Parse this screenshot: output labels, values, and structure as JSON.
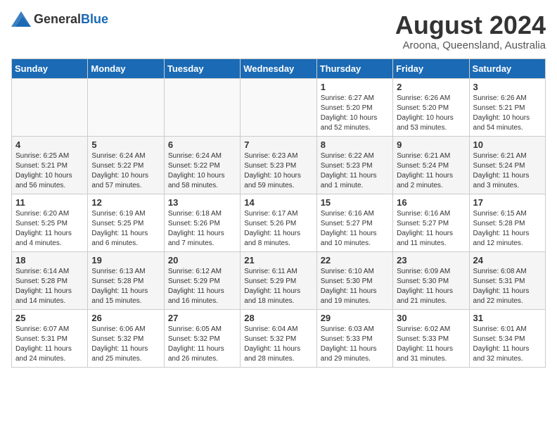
{
  "header": {
    "logo_general": "General",
    "logo_blue": "Blue",
    "month_title": "August 2024",
    "location": "Aroona, Queensland, Australia"
  },
  "days_of_week": [
    "Sunday",
    "Monday",
    "Tuesday",
    "Wednesday",
    "Thursday",
    "Friday",
    "Saturday"
  ],
  "weeks": [
    [
      {
        "day": "",
        "empty": true
      },
      {
        "day": "",
        "empty": true
      },
      {
        "day": "",
        "empty": true
      },
      {
        "day": "",
        "empty": true
      },
      {
        "day": "1",
        "sunrise": "6:27 AM",
        "sunset": "5:20 PM",
        "daylight": "10 hours and 52 minutes."
      },
      {
        "day": "2",
        "sunrise": "6:26 AM",
        "sunset": "5:20 PM",
        "daylight": "10 hours and 53 minutes."
      },
      {
        "day": "3",
        "sunrise": "6:26 AM",
        "sunset": "5:21 PM",
        "daylight": "10 hours and 54 minutes."
      }
    ],
    [
      {
        "day": "4",
        "sunrise": "6:25 AM",
        "sunset": "5:21 PM",
        "daylight": "10 hours and 56 minutes."
      },
      {
        "day": "5",
        "sunrise": "6:24 AM",
        "sunset": "5:22 PM",
        "daylight": "10 hours and 57 minutes."
      },
      {
        "day": "6",
        "sunrise": "6:24 AM",
        "sunset": "5:22 PM",
        "daylight": "10 hours and 58 minutes."
      },
      {
        "day": "7",
        "sunrise": "6:23 AM",
        "sunset": "5:23 PM",
        "daylight": "10 hours and 59 minutes."
      },
      {
        "day": "8",
        "sunrise": "6:22 AM",
        "sunset": "5:23 PM",
        "daylight": "11 hours and 1 minute."
      },
      {
        "day": "9",
        "sunrise": "6:21 AM",
        "sunset": "5:24 PM",
        "daylight": "11 hours and 2 minutes."
      },
      {
        "day": "10",
        "sunrise": "6:21 AM",
        "sunset": "5:24 PM",
        "daylight": "11 hours and 3 minutes."
      }
    ],
    [
      {
        "day": "11",
        "sunrise": "6:20 AM",
        "sunset": "5:25 PM",
        "daylight": "11 hours and 4 minutes."
      },
      {
        "day": "12",
        "sunrise": "6:19 AM",
        "sunset": "5:25 PM",
        "daylight": "11 hours and 6 minutes."
      },
      {
        "day": "13",
        "sunrise": "6:18 AM",
        "sunset": "5:26 PM",
        "daylight": "11 hours and 7 minutes."
      },
      {
        "day": "14",
        "sunrise": "6:17 AM",
        "sunset": "5:26 PM",
        "daylight": "11 hours and 8 minutes."
      },
      {
        "day": "15",
        "sunrise": "6:16 AM",
        "sunset": "5:27 PM",
        "daylight": "11 hours and 10 minutes."
      },
      {
        "day": "16",
        "sunrise": "6:16 AM",
        "sunset": "5:27 PM",
        "daylight": "11 hours and 11 minutes."
      },
      {
        "day": "17",
        "sunrise": "6:15 AM",
        "sunset": "5:28 PM",
        "daylight": "11 hours and 12 minutes."
      }
    ],
    [
      {
        "day": "18",
        "sunrise": "6:14 AM",
        "sunset": "5:28 PM",
        "daylight": "11 hours and 14 minutes."
      },
      {
        "day": "19",
        "sunrise": "6:13 AM",
        "sunset": "5:28 PM",
        "daylight": "11 hours and 15 minutes."
      },
      {
        "day": "20",
        "sunrise": "6:12 AM",
        "sunset": "5:29 PM",
        "daylight": "11 hours and 16 minutes."
      },
      {
        "day": "21",
        "sunrise": "6:11 AM",
        "sunset": "5:29 PM",
        "daylight": "11 hours and 18 minutes."
      },
      {
        "day": "22",
        "sunrise": "6:10 AM",
        "sunset": "5:30 PM",
        "daylight": "11 hours and 19 minutes."
      },
      {
        "day": "23",
        "sunrise": "6:09 AM",
        "sunset": "5:30 PM",
        "daylight": "11 hours and 21 minutes."
      },
      {
        "day": "24",
        "sunrise": "6:08 AM",
        "sunset": "5:31 PM",
        "daylight": "11 hours and 22 minutes."
      }
    ],
    [
      {
        "day": "25",
        "sunrise": "6:07 AM",
        "sunset": "5:31 PM",
        "daylight": "11 hours and 24 minutes."
      },
      {
        "day": "26",
        "sunrise": "6:06 AM",
        "sunset": "5:32 PM",
        "daylight": "11 hours and 25 minutes."
      },
      {
        "day": "27",
        "sunrise": "6:05 AM",
        "sunset": "5:32 PM",
        "daylight": "11 hours and 26 minutes."
      },
      {
        "day": "28",
        "sunrise": "6:04 AM",
        "sunset": "5:32 PM",
        "daylight": "11 hours and 28 minutes."
      },
      {
        "day": "29",
        "sunrise": "6:03 AM",
        "sunset": "5:33 PM",
        "daylight": "11 hours and 29 minutes."
      },
      {
        "day": "30",
        "sunrise": "6:02 AM",
        "sunset": "5:33 PM",
        "daylight": "11 hours and 31 minutes."
      },
      {
        "day": "31",
        "sunrise": "6:01 AM",
        "sunset": "5:34 PM",
        "daylight": "11 hours and 32 minutes."
      }
    ]
  ]
}
